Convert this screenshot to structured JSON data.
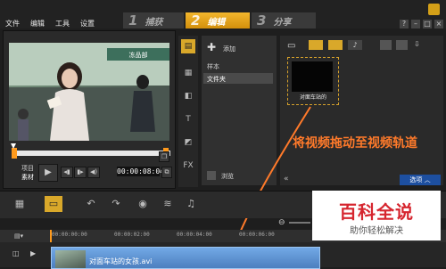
{
  "menu": {
    "file": "文件",
    "edit": "编辑",
    "tools": "工具",
    "settings": "设置"
  },
  "steps": [
    {
      "num": "1",
      "label": "捕获"
    },
    {
      "num": "2",
      "label": "编辑"
    },
    {
      "num": "3",
      "label": "分享"
    }
  ],
  "preview": {
    "project_label": "项目",
    "clip_label": "素材",
    "timecode": "00:00:08:04",
    "shop_sign": "冻品部"
  },
  "library": {
    "add_label": "添加",
    "folders": [
      "样本",
      "文件夹"
    ],
    "browse_label": "浏览",
    "thumbnail_caption": "对面车站的",
    "options_label": "选项"
  },
  "annotation": "将视频拖动至视频轨道",
  "timeline": {
    "ruler_ticks": [
      "00:00:00:00",
      "00:00:02:00",
      "00:00:04:00",
      "00:00:06:00"
    ],
    "clip_label": "对面车站的女孩.avi"
  },
  "watermark": {
    "main": "百科全说",
    "sub": "助你轻松解决"
  }
}
